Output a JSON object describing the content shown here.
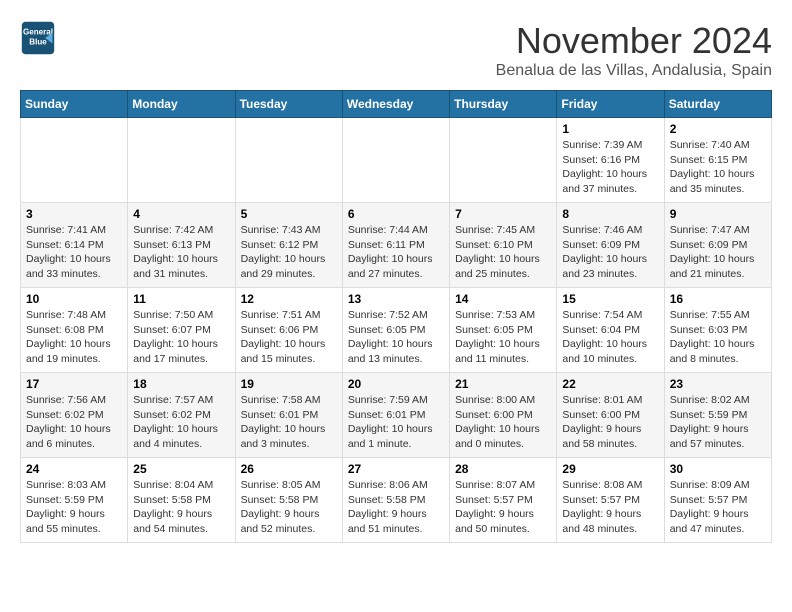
{
  "logo": {
    "line1": "General",
    "line2": "Blue"
  },
  "title": "November 2024",
  "subtitle": "Benalua de las Villas, Andalusia, Spain",
  "days_of_week": [
    "Sunday",
    "Monday",
    "Tuesday",
    "Wednesday",
    "Thursday",
    "Friday",
    "Saturday"
  ],
  "weeks": [
    [
      {
        "day": "",
        "info": ""
      },
      {
        "day": "",
        "info": ""
      },
      {
        "day": "",
        "info": ""
      },
      {
        "day": "",
        "info": ""
      },
      {
        "day": "",
        "info": ""
      },
      {
        "day": "1",
        "info": "Sunrise: 7:39 AM\nSunset: 6:16 PM\nDaylight: 10 hours and 37 minutes."
      },
      {
        "day": "2",
        "info": "Sunrise: 7:40 AM\nSunset: 6:15 PM\nDaylight: 10 hours and 35 minutes."
      }
    ],
    [
      {
        "day": "3",
        "info": "Sunrise: 7:41 AM\nSunset: 6:14 PM\nDaylight: 10 hours and 33 minutes."
      },
      {
        "day": "4",
        "info": "Sunrise: 7:42 AM\nSunset: 6:13 PM\nDaylight: 10 hours and 31 minutes."
      },
      {
        "day": "5",
        "info": "Sunrise: 7:43 AM\nSunset: 6:12 PM\nDaylight: 10 hours and 29 minutes."
      },
      {
        "day": "6",
        "info": "Sunrise: 7:44 AM\nSunset: 6:11 PM\nDaylight: 10 hours and 27 minutes."
      },
      {
        "day": "7",
        "info": "Sunrise: 7:45 AM\nSunset: 6:10 PM\nDaylight: 10 hours and 25 minutes."
      },
      {
        "day": "8",
        "info": "Sunrise: 7:46 AM\nSunset: 6:09 PM\nDaylight: 10 hours and 23 minutes."
      },
      {
        "day": "9",
        "info": "Sunrise: 7:47 AM\nSunset: 6:09 PM\nDaylight: 10 hours and 21 minutes."
      }
    ],
    [
      {
        "day": "10",
        "info": "Sunrise: 7:48 AM\nSunset: 6:08 PM\nDaylight: 10 hours and 19 minutes."
      },
      {
        "day": "11",
        "info": "Sunrise: 7:50 AM\nSunset: 6:07 PM\nDaylight: 10 hours and 17 minutes."
      },
      {
        "day": "12",
        "info": "Sunrise: 7:51 AM\nSunset: 6:06 PM\nDaylight: 10 hours and 15 minutes."
      },
      {
        "day": "13",
        "info": "Sunrise: 7:52 AM\nSunset: 6:05 PM\nDaylight: 10 hours and 13 minutes."
      },
      {
        "day": "14",
        "info": "Sunrise: 7:53 AM\nSunset: 6:05 PM\nDaylight: 10 hours and 11 minutes."
      },
      {
        "day": "15",
        "info": "Sunrise: 7:54 AM\nSunset: 6:04 PM\nDaylight: 10 hours and 10 minutes."
      },
      {
        "day": "16",
        "info": "Sunrise: 7:55 AM\nSunset: 6:03 PM\nDaylight: 10 hours and 8 minutes."
      }
    ],
    [
      {
        "day": "17",
        "info": "Sunrise: 7:56 AM\nSunset: 6:02 PM\nDaylight: 10 hours and 6 minutes."
      },
      {
        "day": "18",
        "info": "Sunrise: 7:57 AM\nSunset: 6:02 PM\nDaylight: 10 hours and 4 minutes."
      },
      {
        "day": "19",
        "info": "Sunrise: 7:58 AM\nSunset: 6:01 PM\nDaylight: 10 hours and 3 minutes."
      },
      {
        "day": "20",
        "info": "Sunrise: 7:59 AM\nSunset: 6:01 PM\nDaylight: 10 hours and 1 minute."
      },
      {
        "day": "21",
        "info": "Sunrise: 8:00 AM\nSunset: 6:00 PM\nDaylight: 10 hours and 0 minutes."
      },
      {
        "day": "22",
        "info": "Sunrise: 8:01 AM\nSunset: 6:00 PM\nDaylight: 9 hours and 58 minutes."
      },
      {
        "day": "23",
        "info": "Sunrise: 8:02 AM\nSunset: 5:59 PM\nDaylight: 9 hours and 57 minutes."
      }
    ],
    [
      {
        "day": "24",
        "info": "Sunrise: 8:03 AM\nSunset: 5:59 PM\nDaylight: 9 hours and 55 minutes."
      },
      {
        "day": "25",
        "info": "Sunrise: 8:04 AM\nSunset: 5:58 PM\nDaylight: 9 hours and 54 minutes."
      },
      {
        "day": "26",
        "info": "Sunrise: 8:05 AM\nSunset: 5:58 PM\nDaylight: 9 hours and 52 minutes."
      },
      {
        "day": "27",
        "info": "Sunrise: 8:06 AM\nSunset: 5:58 PM\nDaylight: 9 hours and 51 minutes."
      },
      {
        "day": "28",
        "info": "Sunrise: 8:07 AM\nSunset: 5:57 PM\nDaylight: 9 hours and 50 minutes."
      },
      {
        "day": "29",
        "info": "Sunrise: 8:08 AM\nSunset: 5:57 PM\nDaylight: 9 hours and 48 minutes."
      },
      {
        "day": "30",
        "info": "Sunrise: 8:09 AM\nSunset: 5:57 PM\nDaylight: 9 hours and 47 minutes."
      }
    ]
  ],
  "colors": {
    "header_bg": "#2471a3",
    "header_text": "#ffffff",
    "title_color": "#333333",
    "accent": "#1a5276"
  }
}
